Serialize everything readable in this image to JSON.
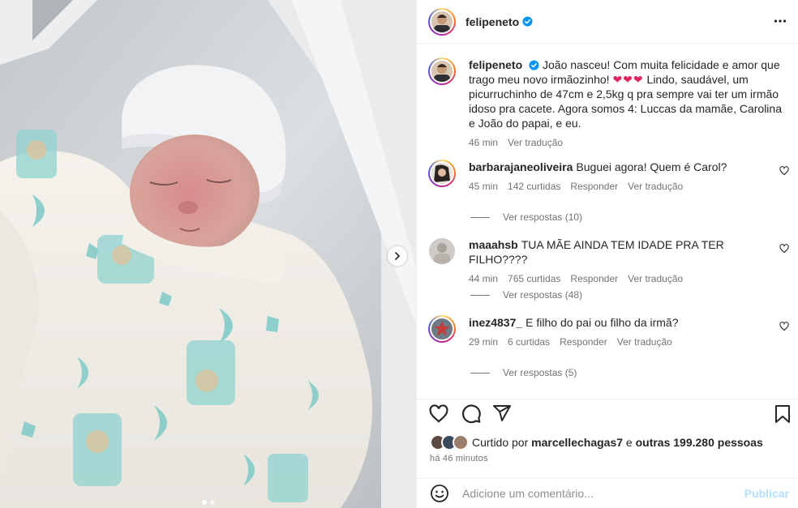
{
  "post": {
    "author": "felipeneto",
    "caption_author": "felipeneto",
    "caption": "João nasceu! Com muita felicidade e amor que trago meu novo irmãozinho! ❤️❤️❤️ Lindo, saudável, um picurruchinho de 47cm e 2,5kg q pra sempre vai ter um irmão idoso pra cacete. Agora somos 4: Luccas da mamãe, Carolina e João do papai, e eu.",
    "caption_before_hearts": "João nasceu! Com muita felicidade e amor que trago meu novo irmãozinho!",
    "caption_hearts": "❤❤❤",
    "caption_after_hearts": "Lindo, saudável, um picurruchinho de 47cm e 2,5kg q pra sempre vai ter um irmão idoso pra cacete. Agora somos 4: Luccas da mamãe, Carolina e João do papai, e eu.",
    "caption_time": "46 min",
    "caption_translate": "Ver tradução"
  },
  "comments": [
    {
      "user": "barbarajaneoliveira",
      "text": "Buguei agora! Quem é Carol?",
      "time": "45 min",
      "likes": "142 curtidas",
      "reply": "Responder",
      "translate": "Ver tradução",
      "view_replies": "Ver respostas (10)"
    },
    {
      "user": "maaahsb",
      "text": "TUA MÃE AINDA TEM IDADE PRA TER FILHO????",
      "time": "44 min",
      "likes": "765 curtidas",
      "reply": "Responder",
      "translate": "Ver tradução",
      "view_replies": "Ver respostas (48)"
    },
    {
      "user": "inez4837_",
      "text": "E filho do pai ou filho da irmã?",
      "time": "29 min",
      "likes": "6 curtidas",
      "reply": "Responder",
      "translate": "Ver tradução",
      "view_replies": "Ver respostas (5)"
    }
  ],
  "likes": {
    "prefix": "Curtido por",
    "user": "marcellechagas7",
    "middle": "e",
    "others": "outras 199.280 pessoas"
  },
  "posted_ago": "há 46 minutos",
  "add_comment": {
    "placeholder": "Adicione um comentário...",
    "publish": "Publicar"
  },
  "carousel": {
    "slides": 2,
    "active": 1
  },
  "colors": {
    "verified": "#0095f6",
    "publish_disabled": "#b2dffc",
    "secondary_text": "#737373",
    "heart_emoji": "#e0245e"
  },
  "icons": [
    "verified-icon",
    "more-options-icon",
    "heart-icon",
    "comment-icon",
    "share-icon",
    "bookmark-icon",
    "emoji-icon",
    "chevron-right-icon"
  ]
}
